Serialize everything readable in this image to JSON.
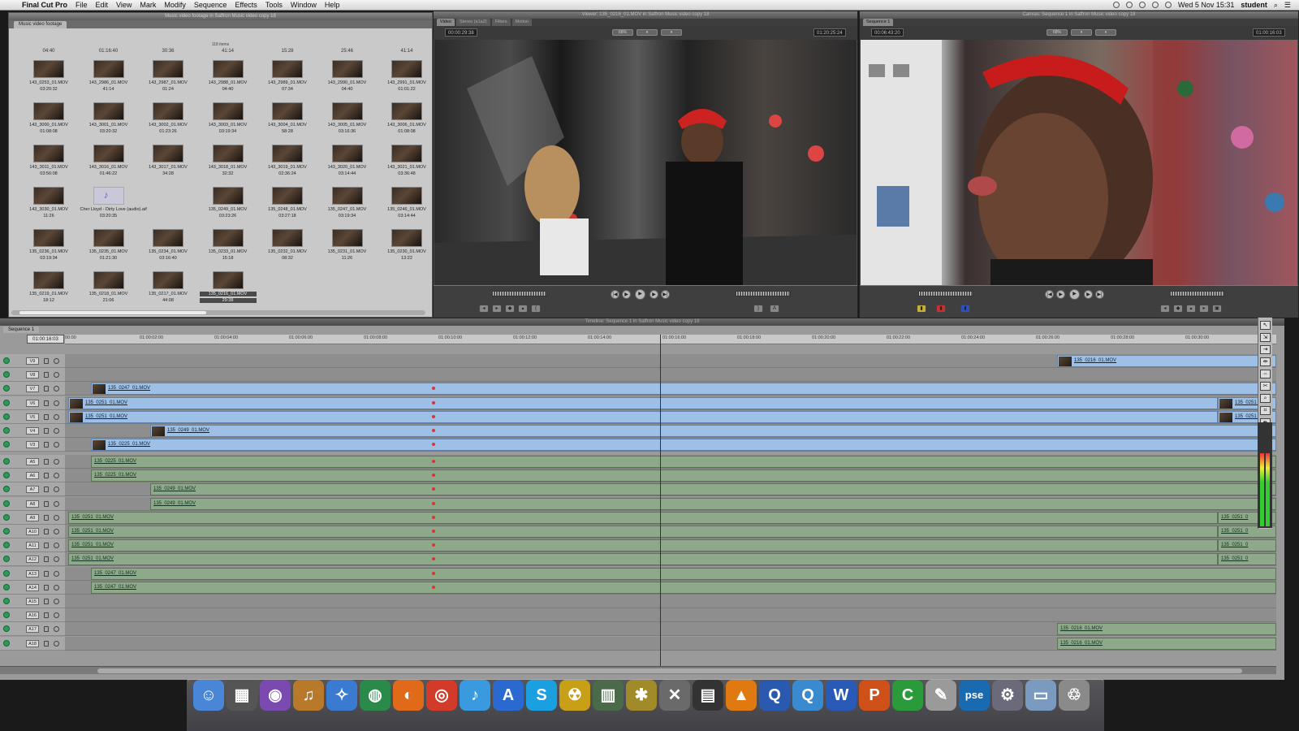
{
  "menubar": {
    "app": "Final Cut Pro",
    "items": [
      "File",
      "Edit",
      "View",
      "Mark",
      "Modify",
      "Sequence",
      "Effects",
      "Tools",
      "Window",
      "Help"
    ],
    "datetime": "Wed 5 Nov  15:31",
    "user": "student"
  },
  "browser": {
    "title": "Music video footage in Saffron Music video copy 18",
    "tab": "Music video footage",
    "item_count": "118 items",
    "top_durations": [
      "04:40",
      "01:16:40",
      "30:36",
      "41:14",
      "15:28",
      "25:46",
      "41:14"
    ],
    "clips": [
      {
        "name": "143_0253_01.MOV",
        "dur": "03:20:32"
      },
      {
        "name": "143_2986_01.MOV",
        "dur": "41:14"
      },
      {
        "name": "143_2987_01.MOV",
        "dur": "01:24"
      },
      {
        "name": "143_2988_01.MOV",
        "dur": "04:40"
      },
      {
        "name": "143_2989_01.MOV",
        "dur": "07:34"
      },
      {
        "name": "143_2990_01.MOV",
        "dur": "04:40"
      },
      {
        "name": "143_2991_01.MOV",
        "dur": "01:01:22"
      },
      {
        "name": "143_3000_01.MOV",
        "dur": "01:08:08"
      },
      {
        "name": "143_3001_01.MOV",
        "dur": "03:20:32"
      },
      {
        "name": "143_3002_01.MOV",
        "dur": "01:23:26"
      },
      {
        "name": "143_3003_01.MOV",
        "dur": "03:19:34"
      },
      {
        "name": "143_3004_01.MOV",
        "dur": "58:28"
      },
      {
        "name": "143_3005_01.MOV",
        "dur": "03:16:36"
      },
      {
        "name": "143_3006_01.MOV",
        "dur": "01:08:08"
      },
      {
        "name": "143_3011_01.MOV",
        "dur": "03:56:08"
      },
      {
        "name": "143_3016_01.MOV",
        "dur": "01:46:22"
      },
      {
        "name": "143_3017_01.MOV",
        "dur": "34:28"
      },
      {
        "name": "143_3018_01.MOV",
        "dur": "32:32"
      },
      {
        "name": "143_3019_01.MOV",
        "dur": "02:36:24"
      },
      {
        "name": "143_3020_01.MOV",
        "dur": "03:14:44"
      },
      {
        "name": "143_3021_01.MOV",
        "dur": "03:36:48"
      },
      {
        "name": "143_3030_01.MOV",
        "dur": "11:26"
      },
      {
        "name": "Cher Lloyd - Dirty Love (audio).aif",
        "dur": "03:20:35",
        "audio": true
      },
      {
        "name": "",
        "dur": ""
      },
      {
        "name": "135_0249_01.MOV",
        "dur": "03:23:26"
      },
      {
        "name": "135_0248_01.MOV",
        "dur": "03:27:18"
      },
      {
        "name": "135_0247_01.MOV",
        "dur": "03:19:34"
      },
      {
        "name": "135_0246_01.MOV",
        "dur": "03:14:44"
      },
      {
        "name": "135_0236_01.MOV",
        "dur": "03:19:34"
      },
      {
        "name": "135_0235_01.MOV",
        "dur": "01:21:30"
      },
      {
        "name": "135_0234_01.MOV",
        "dur": "03:16:40"
      },
      {
        "name": "135_0233_01.MOV",
        "dur": "15:18"
      },
      {
        "name": "135_0232_01.MOV",
        "dur": "08:32"
      },
      {
        "name": "135_0231_01.MOV",
        "dur": "11:26"
      },
      {
        "name": "135_0230_01.MOV",
        "dur": "13:22"
      },
      {
        "name": "135_0219_01.MOV",
        "dur": "18:12"
      },
      {
        "name": "135_0218_01.MOV",
        "dur": "21:06"
      },
      {
        "name": "135_0217_01.MOV",
        "dur": "44:08"
      },
      {
        "name": "135_0216_01.MOV",
        "dur": "29:38",
        "selected": true
      }
    ]
  },
  "viewer": {
    "title": "Viewer: 135_0216_01.MOV in Saffron Music video copy 18",
    "tabs": [
      "Video",
      "Stereo (a1a2)",
      "Filters",
      "Motion"
    ],
    "duration": "00:00:29:38",
    "zoom": "68%",
    "current": "01:20:25:24"
  },
  "canvas": {
    "title": "Canvas: Sequence 1 in Saffron Music video copy 18",
    "tab": "Sequence 1",
    "duration": "00:06:43:20",
    "zoom": "68%",
    "current": "01:00:16:03"
  },
  "timeline": {
    "title": "Timeline: Sequence 1 in Saffron Music video copy 18",
    "tab": "Sequence 1",
    "timecode": "01:00:16:03",
    "ruler": [
      "00:00",
      "01:00:02:00",
      "01:00:04:00",
      "01:00:06:00",
      "01:00:08:00",
      "01:00:10:00",
      "01:00:12:00",
      "01:00:14:00",
      "01:00:16:00",
      "01:00:18:00",
      "01:00:20:00",
      "01:00:22:00",
      "01:00:24:00",
      "01:00:26:00",
      "01:00:28:00",
      "01:00:30:00",
      "01:00"
    ],
    "video_tracks": [
      {
        "label": "V9",
        "clips": [
          {
            "name": "135_0216_01.MOV"
          }
        ]
      },
      {
        "label": "V8",
        "clips": []
      },
      {
        "label": "V7",
        "clips": [
          {
            "name": "135_0247_01.MOV"
          }
        ]
      },
      {
        "label": "V6",
        "clips": [
          {
            "name": "135_0251_01.MOV"
          },
          {
            "name": "135_0251_0"
          }
        ]
      },
      {
        "label": "V5",
        "clips": [
          {
            "name": "135_0251_01.MOV"
          },
          {
            "name": "135_0251_0"
          }
        ]
      },
      {
        "label": "V4",
        "clips": [
          {
            "name": "135_0249_01.MOV"
          }
        ]
      },
      {
        "label": "V3",
        "clips": [
          {
            "name": "135_0225_01.MOV"
          }
        ]
      }
    ],
    "audio_tracks": [
      {
        "label": "A5",
        "clips": [
          {
            "name": "135_0225_01.MOV"
          }
        ]
      },
      {
        "label": "A6",
        "clips": [
          {
            "name": "135_0225_01.MOV"
          }
        ]
      },
      {
        "label": "A7",
        "clips": [
          {
            "name": "135_0249_01.MOV"
          }
        ]
      },
      {
        "label": "A8",
        "clips": [
          {
            "name": "135_0249_01.MOV"
          }
        ]
      },
      {
        "label": "A9",
        "clips": [
          {
            "name": "135_0251_01.MOV"
          },
          {
            "name": "135_0251_0"
          }
        ]
      },
      {
        "label": "A10",
        "clips": [
          {
            "name": "135_0251_01.MOV"
          },
          {
            "name": "135_0251_0"
          }
        ]
      },
      {
        "label": "A11",
        "clips": [
          {
            "name": "135_0251_01.MOV"
          },
          {
            "name": "135_0251_0"
          }
        ]
      },
      {
        "label": "A12",
        "clips": [
          {
            "name": "135_0251_01.MOV"
          },
          {
            "name": "135_0251_0"
          }
        ]
      },
      {
        "label": "A13",
        "clips": [
          {
            "name": "135_0247_01.MOV"
          }
        ]
      },
      {
        "label": "A14",
        "clips": [
          {
            "name": "135_0247_01.MOV"
          }
        ]
      },
      {
        "label": "A15",
        "clips": []
      },
      {
        "label": "A16",
        "clips": []
      },
      {
        "label": "A17",
        "clips": [
          {
            "name": "135_0216_01.MOV"
          }
        ]
      },
      {
        "label": "A18",
        "clips": [
          {
            "name": "135_0216_01.MOV"
          }
        ]
      }
    ]
  },
  "dock": {
    "apps": [
      {
        "icon": "finder-icon",
        "glyph": "☺",
        "color": "#4a86d8"
      },
      {
        "icon": "clapper-icon",
        "glyph": "▦",
        "color": "#555555"
      },
      {
        "icon": "photo-booth-icon",
        "glyph": "◉",
        "color": "#7a4ab0"
      },
      {
        "icon": "garageband-icon",
        "glyph": "♫",
        "color": "#b87a2a"
      },
      {
        "icon": "safari-icon",
        "glyph": "✧",
        "color": "#3a7ad0"
      },
      {
        "icon": "globe-icon",
        "glyph": "◍",
        "color": "#2a8a4a"
      },
      {
        "icon": "firefox-icon",
        "glyph": "◐",
        "color": "#e06a1a"
      },
      {
        "icon": "chrome-icon",
        "glyph": "◎",
        "color": "#d23a2a"
      },
      {
        "icon": "itunes-icon",
        "glyph": "♪",
        "color": "#3a9ae0"
      },
      {
        "icon": "app-store-icon",
        "glyph": "A",
        "color": "#2a6ad0"
      },
      {
        "icon": "skype-icon",
        "glyph": "S",
        "color": "#1aa0e0"
      },
      {
        "icon": "radiation-icon",
        "glyph": "☢",
        "color": "#c8a018"
      },
      {
        "icon": "film-strip-icon",
        "glyph": "▥",
        "color": "#4a6a4a"
      },
      {
        "icon": "pineapple-icon",
        "glyph": "✱",
        "color": "#a08a2a"
      },
      {
        "icon": "x-tool-icon",
        "glyph": "✕",
        "color": "#6a6a6a"
      },
      {
        "icon": "clapperboard-icon",
        "glyph": "▤",
        "color": "#333333"
      },
      {
        "icon": "vlc-icon",
        "glyph": "▲",
        "color": "#e07a10"
      },
      {
        "icon": "quicktime-icon",
        "glyph": "Q",
        "color": "#2a5ab0"
      },
      {
        "icon": "quicktime-x-icon",
        "glyph": "Q",
        "color": "#3a8ad0"
      },
      {
        "icon": "word-icon",
        "glyph": "W",
        "color": "#2a5ab8"
      },
      {
        "icon": "powerpoint-icon",
        "glyph": "P",
        "color": "#d0501a"
      },
      {
        "icon": "camtasia-icon",
        "glyph": "C",
        "color": "#2a9a3a"
      },
      {
        "icon": "textedit-icon",
        "glyph": "✎",
        "color": "#9a9a9a"
      },
      {
        "icon": "photoshop-elements-icon",
        "glyph": "pse",
        "color": "#1a6ab0"
      },
      {
        "icon": "system-preferences-icon",
        "glyph": "⚙",
        "color": "#6a6a7a"
      },
      {
        "icon": "folder-icon",
        "glyph": "▭",
        "color": "#7a9ac0"
      },
      {
        "icon": "trash-icon",
        "glyph": "♲",
        "color": "#8a8a8a"
      }
    ]
  }
}
